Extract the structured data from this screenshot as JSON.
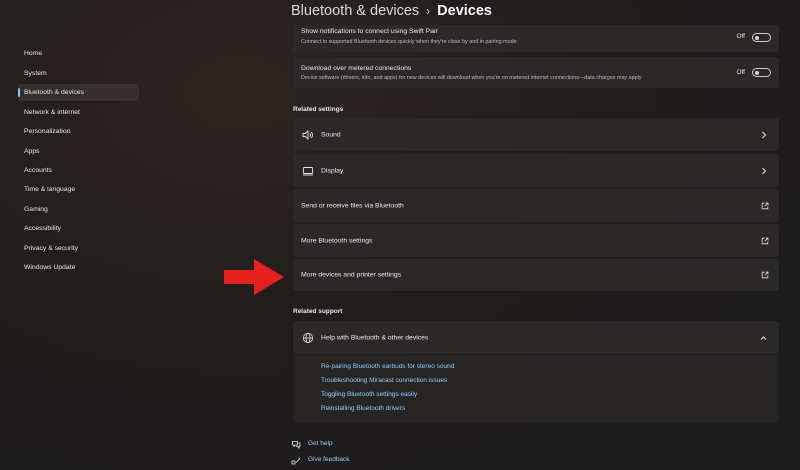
{
  "breadcrumb": {
    "parent": "Bluetooth & devices",
    "separator": "›",
    "current": "Devices"
  },
  "sidebar": {
    "items": [
      {
        "label": "Home",
        "active": false
      },
      {
        "label": "System",
        "active": false
      },
      {
        "label": "Bluetooth & devices",
        "active": true
      },
      {
        "label": "Network & internet",
        "active": false
      },
      {
        "label": "Personalization",
        "active": false
      },
      {
        "label": "Apps",
        "active": false
      },
      {
        "label": "Accounts",
        "active": false
      },
      {
        "label": "Time & language",
        "active": false
      },
      {
        "label": "Gaming",
        "active": false
      },
      {
        "label": "Accessibility",
        "active": false
      },
      {
        "label": "Privacy & security",
        "active": false
      },
      {
        "label": "Windows Update",
        "active": false
      }
    ]
  },
  "toggles": [
    {
      "title": "Show notifications to connect using Swift Pair",
      "description": "Connect to supported Bluetooth devices quickly when they're close by and in pairing mode",
      "state": "Off"
    },
    {
      "title": "Download over metered connections",
      "description": "Device software (drivers, info, and apps) for new devices will download when you're on metered internet connections—data charges may apply",
      "state": "Off"
    }
  ],
  "related_settings": {
    "heading": "Related settings",
    "items": [
      {
        "label": "Sound",
        "icon": "speaker-icon",
        "trail": "chevron-right-icon"
      },
      {
        "label": "Display",
        "icon": "monitor-icon",
        "trail": "chevron-right-icon"
      },
      {
        "label": "Send or receive files via Bluetooth",
        "icon": "",
        "trail": "external-link-icon"
      },
      {
        "label": "More Bluetooth settings",
        "icon": "",
        "trail": "external-link-icon"
      },
      {
        "label": "More devices and printer settings",
        "icon": "",
        "trail": "external-link-icon"
      }
    ]
  },
  "related_support": {
    "heading": "Related support",
    "expander_label": "Help with Bluetooth & other devices",
    "links": [
      "Re-pairing Bluetooth earbuds for stereo sound",
      "Troubleshooting Miracast connection issues",
      "Toggling Bluetooth settings easily",
      "Reinstalling Bluetooth drivers"
    ]
  },
  "footer": {
    "get_help": "Get help",
    "give_feedback": "Give feedback"
  },
  "colors": {
    "accent": "#7ec3ff",
    "link": "#8fd0ff",
    "arrow": "#e8201c",
    "card": "#2b2827"
  }
}
